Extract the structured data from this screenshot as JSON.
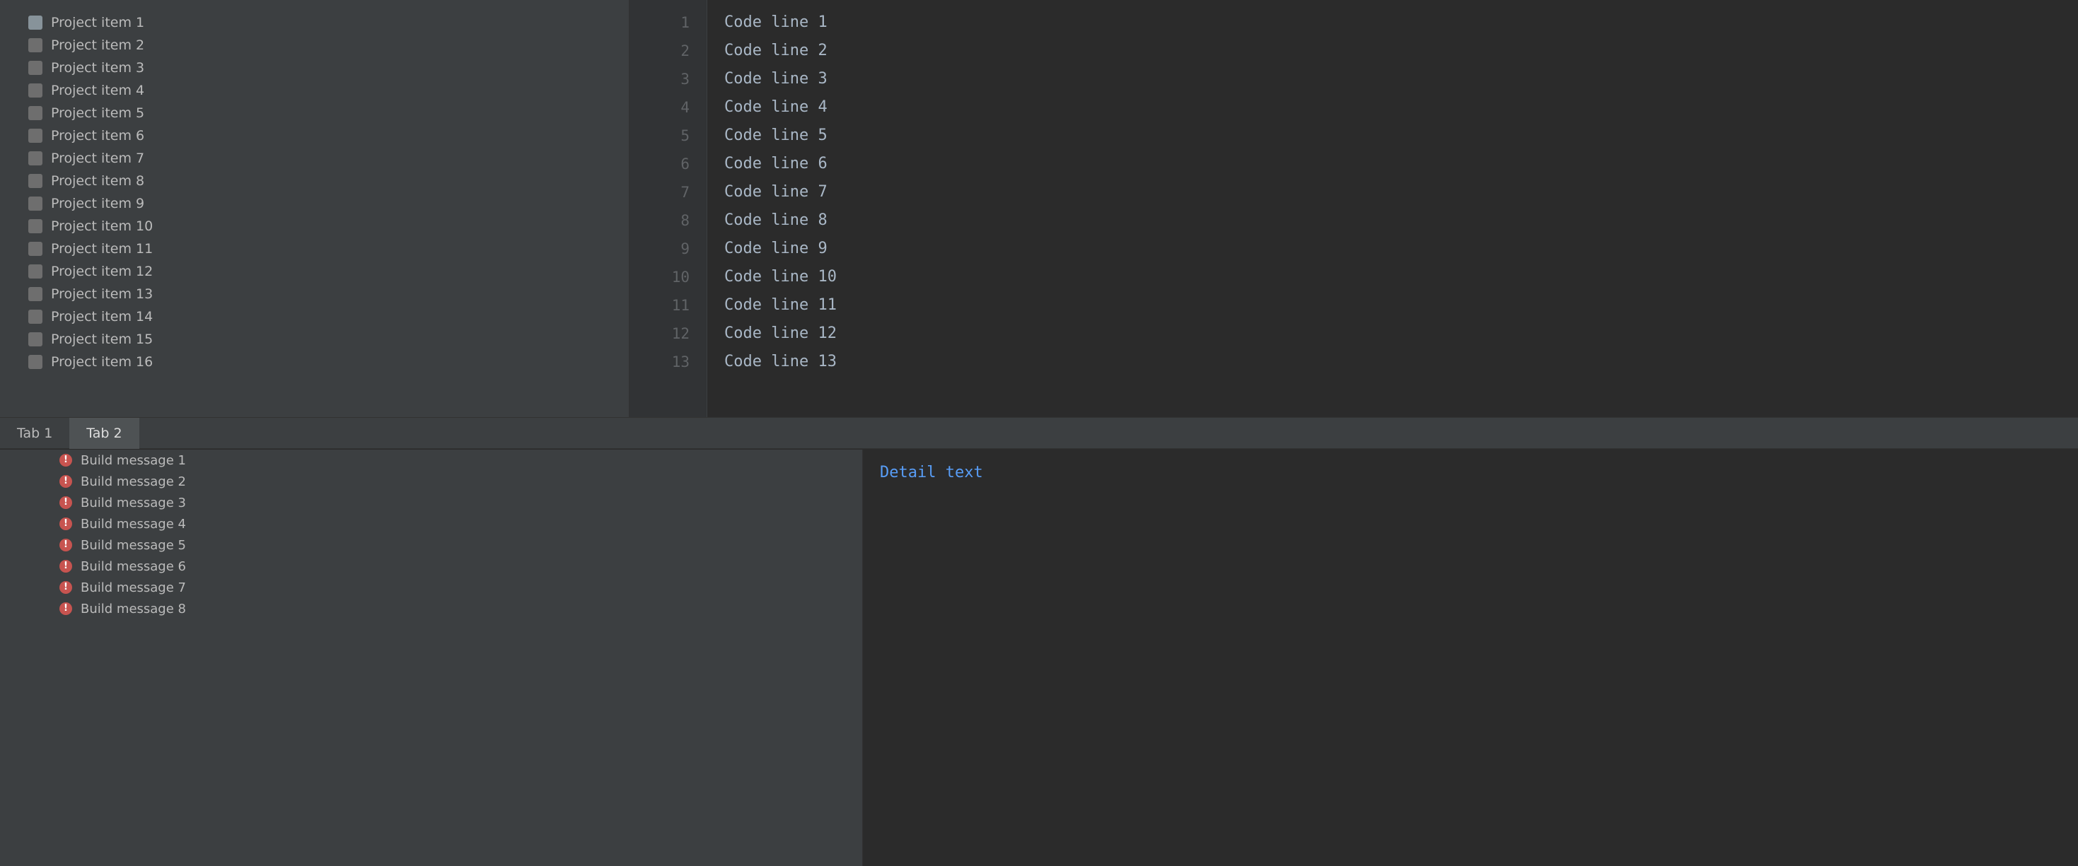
{
  "project_tree": [
    "Project item 1",
    "Project item 2",
    "Project item 3",
    "Project item 4",
    "Project item 5",
    "Project item 6",
    "Project item 7",
    "Project item 8",
    "Project item 9",
    "Project item 10",
    "Project item 11",
    "Project item 12",
    "Project item 13",
    "Project item 14",
    "Project item 15",
    "Project item 16"
  ],
  "editor": {
    "lines": [
      {
        "no": "1",
        "text": "Code line 1"
      },
      {
        "no": "2",
        "text": "Code line 2"
      },
      {
        "no": "3",
        "text": "Code line 3"
      },
      {
        "no": "4",
        "text": "Code line 4"
      },
      {
        "no": "5",
        "text": "Code line 5"
      },
      {
        "no": "6",
        "text": "Code line 6"
      },
      {
        "no": "7",
        "text": "Code line 7"
      },
      {
        "no": "8",
        "text": "Code line 8"
      },
      {
        "no": "9",
        "text": "Code line 9"
      },
      {
        "no": "10",
        "text": "Code line 10"
      },
      {
        "no": "11",
        "text": "Code line 11"
      },
      {
        "no": "12",
        "text": "Code line 12"
      },
      {
        "no": "13",
        "text": "Code line 13"
      }
    ]
  },
  "bottom_tabs": [
    "Tab 1",
    "Tab 2"
  ],
  "build_messages": [
    "Build message 1",
    "Build message 2",
    "Build message 3",
    "Build message 4",
    "Build message 5",
    "Build message 6",
    "Build message 7",
    "Build message 8"
  ],
  "detail_text": "Detail text"
}
